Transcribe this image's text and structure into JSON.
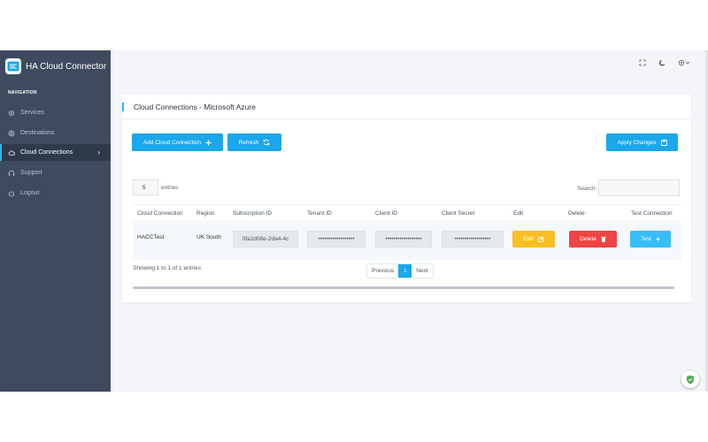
{
  "brand": {
    "name": "HA Cloud Connector"
  },
  "sidebar": {
    "heading": "NAVIGATION",
    "items": [
      {
        "label": "Services",
        "icon": "gear-icon"
      },
      {
        "label": "Destinations",
        "icon": "globe-icon"
      },
      {
        "label": "Cloud Connections",
        "icon": "cloud-icon",
        "active": true
      },
      {
        "label": "Support",
        "icon": "headset-icon"
      },
      {
        "label": "Logout",
        "icon": "power-icon"
      }
    ]
  },
  "topbar": {
    "icons": [
      "fullscreen-icon",
      "moon-icon",
      "settings-dropdown-icon"
    ]
  },
  "card": {
    "title": "Cloud Connections - Microsoft Azure",
    "add_label": "Add Cloud Connection",
    "refresh_label": "Refresh",
    "apply_label": "Apply Changes"
  },
  "table": {
    "length_value": "5",
    "length_suffix": "entries",
    "search_label": "Search:",
    "search_value": "",
    "columns": [
      "Cloud Connection",
      "Region",
      "Subscription ID",
      "Tenant ID",
      "Client ID",
      "Client Secret",
      "Edit",
      "Delete",
      "Test Connection"
    ],
    "rows": [
      {
        "name": "HACCTest",
        "region": "UK South",
        "subscription_id": "0fa2d08e-2da4-4c",
        "tenant_id": "••••••••••••••••••",
        "client_id": "••••••••••••••••••",
        "client_secret": "••••••••••••••••••",
        "edit_label": "Edit",
        "delete_label": "Delete",
        "test_label": "Test"
      }
    ],
    "info": "Showing 1 to 1 of 1 entries",
    "pagination": {
      "previous": "Previous",
      "current": "1",
      "next": "Next"
    }
  },
  "colors": {
    "sidebar": "#3e4b5e",
    "accent": "#1aa7ec",
    "warning": "#fbbf24",
    "danger": "#ef4444",
    "info": "#38bdf8"
  }
}
